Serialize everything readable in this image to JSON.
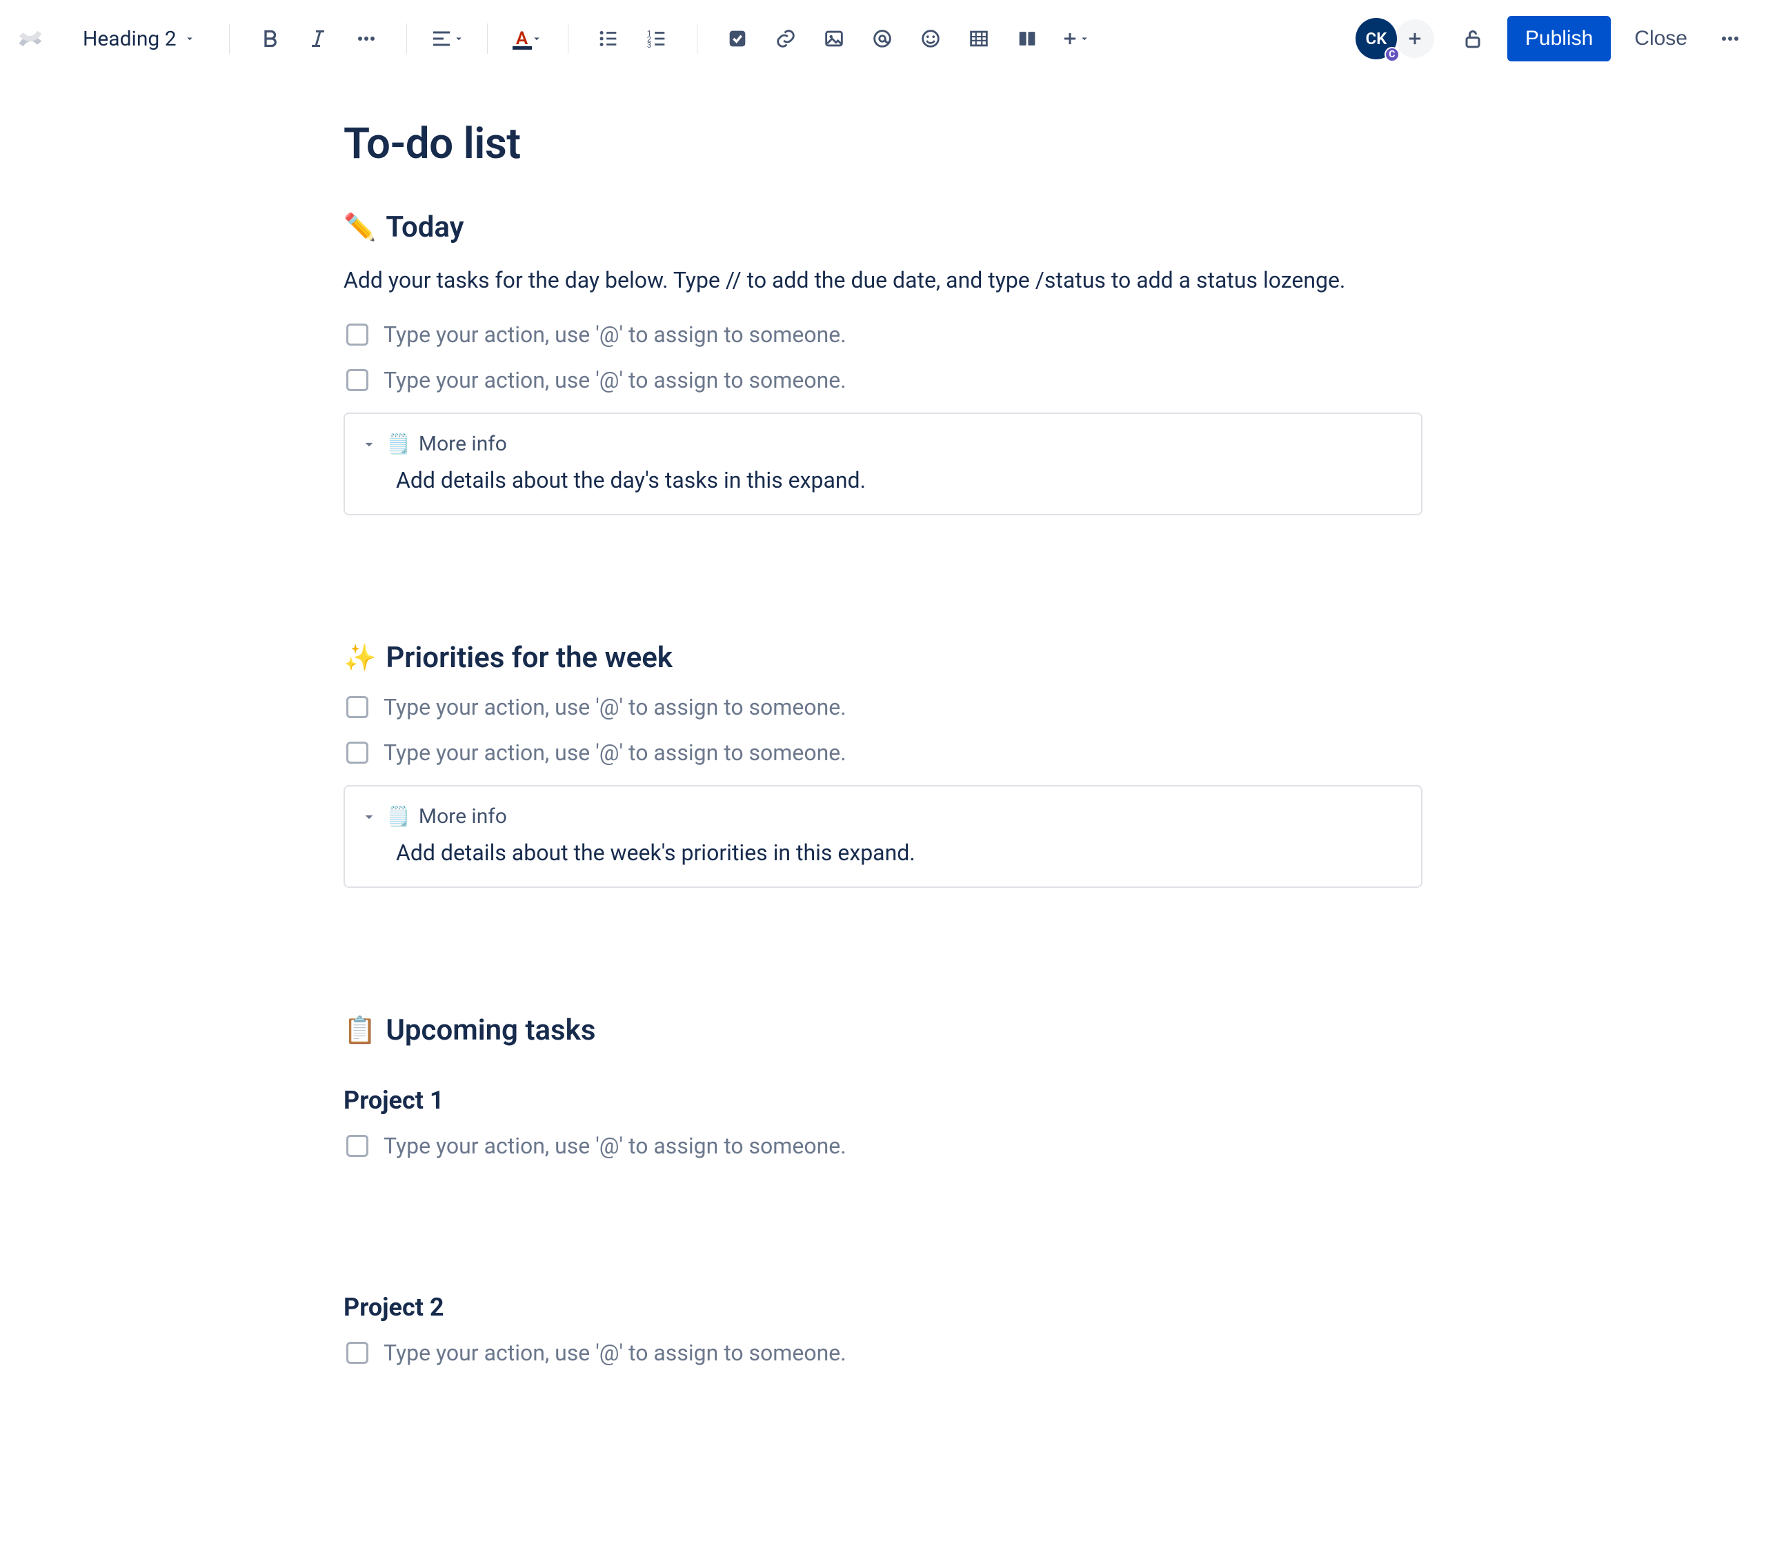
{
  "toolbar": {
    "textStyle": "Heading 2",
    "avatar": "CK",
    "avatarBadge": "C",
    "publish": "Publish",
    "close": "Close"
  },
  "page": {
    "title": "To-do list"
  },
  "sections": {
    "today": {
      "emoji": "✏️",
      "heading": "Today",
      "desc": "Add your tasks for the day below. Type // to add the due date, and type /status to add a status lozenge.",
      "taskPlaceholder1": "Type your action, use '@' to assign to someone.",
      "taskPlaceholder2": "Type your action, use '@' to assign to someone.",
      "expand": {
        "label": "More info",
        "body": "Add details about the day's tasks in this expand."
      }
    },
    "week": {
      "emoji": "✨",
      "heading": "Priorities for the week",
      "taskPlaceholder1": "Type your action, use '@' to assign to someone.",
      "taskPlaceholder2": "Type your action, use '@' to assign to someone.",
      "expand": {
        "label": "More info",
        "body": "Add details about the week's priorities in this expand."
      }
    },
    "upcoming": {
      "emoji": "📋",
      "heading": "Upcoming tasks",
      "project1": {
        "title": "Project 1",
        "taskPlaceholder": "Type your action, use '@' to assign to someone."
      },
      "project2": {
        "title": "Project 2",
        "taskPlaceholder": "Type your action, use '@' to assign to someone."
      }
    }
  }
}
